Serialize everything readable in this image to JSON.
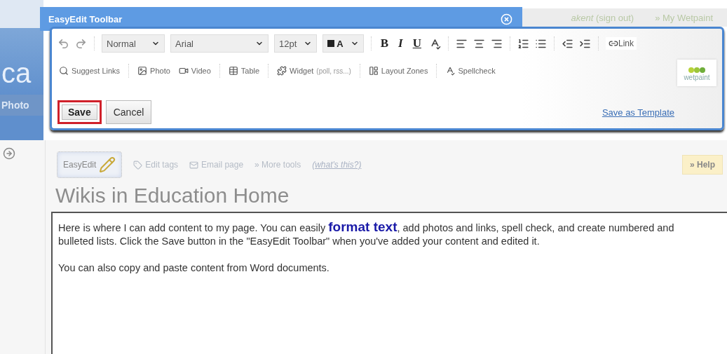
{
  "site_header": {
    "logo_fragment": "ca",
    "nav_fragment": "Photo",
    "user_fragment": "akent",
    "sign_out": "(sign out)",
    "my_wetpaint": "» My Wetpaint"
  },
  "toolbar": {
    "title": "EasyEdit Toolbar",
    "selects": [
      {
        "kind": "style",
        "value": "Normal"
      },
      {
        "kind": "font",
        "value": "Arial"
      },
      {
        "kind": "size",
        "value": "12pt"
      }
    ],
    "text_color": "A",
    "bold": "B",
    "italic": "I",
    "underline": "U",
    "link": "Link",
    "insert_items": [
      {
        "kind": "suggest",
        "label": "Suggest Links"
      },
      {
        "kind": "photo",
        "label": "Photo"
      },
      {
        "kind": "video",
        "label": "Video"
      },
      {
        "kind": "table",
        "label": "Table"
      },
      {
        "kind": "widget",
        "label": "Widget",
        "hint": "(poll, rss...)"
      },
      {
        "kind": "layout",
        "label": "Layout Zones"
      },
      {
        "kind": "spellcheck",
        "label": "Spellcheck"
      }
    ],
    "brand": "wetpaint",
    "save_button": {
      "label": "Save",
      "highlighted": true
    },
    "cancel_button": "Cancel",
    "save_as_template": "Save as Template"
  },
  "page": {
    "easyedit_button": "EasyEdit",
    "tools": [
      {
        "kind": "tags",
        "label": "Edit tags"
      },
      {
        "kind": "email",
        "label": "Email page"
      },
      {
        "kind": "more",
        "label": "» More tools"
      }
    ],
    "whats_this": "(what's this?)",
    "help": "» Help",
    "title": "Wikis in Education Home",
    "paragraphs": [
      "Here is where I can add content to my page. You can easily **format text**, add photos and links, spell check, and create numbered and bulleted lists. Click the Save button in the \"EasyEdit Toolbar\" when you've added your content and edited it.",
      "You can also copy and paste content from Word documents."
    ]
  }
}
